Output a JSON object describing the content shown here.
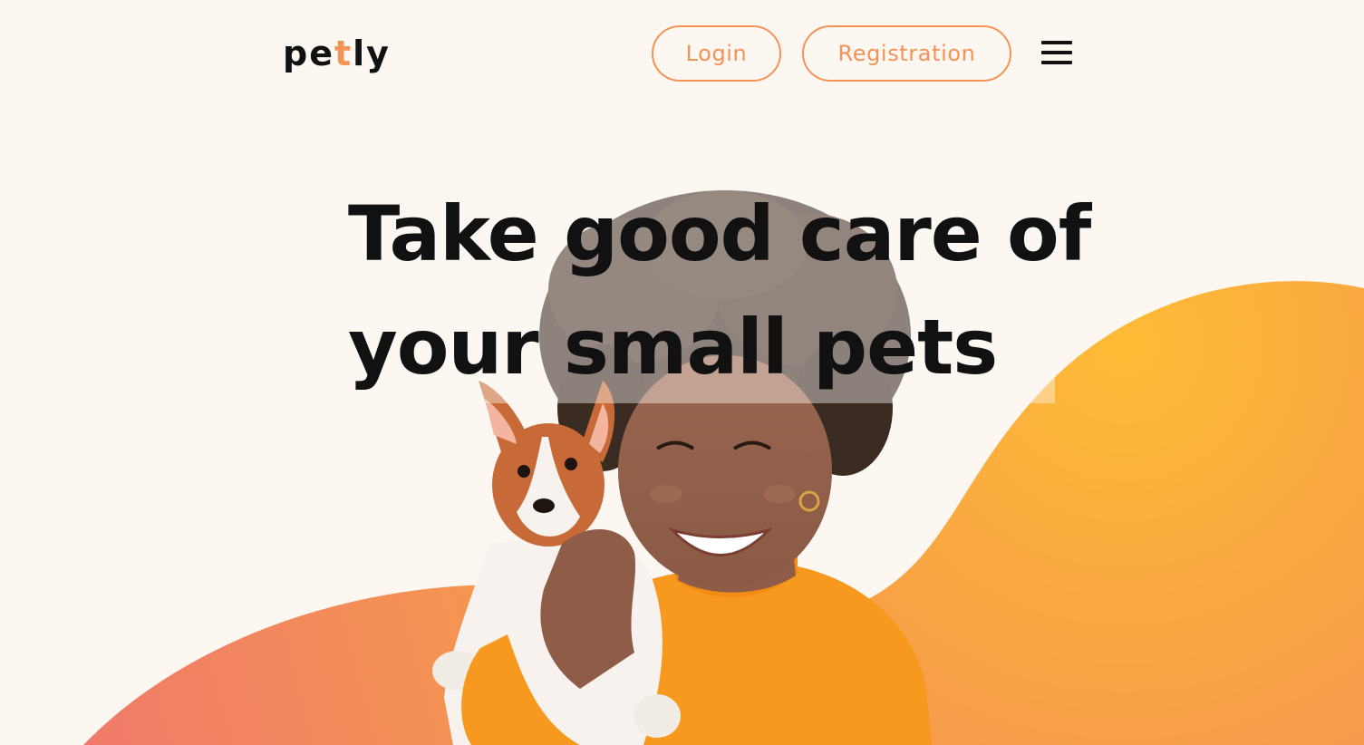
{
  "header": {
    "logo_start": "pe",
    "logo_accent": "t",
    "logo_end": "ly",
    "login_label": "Login",
    "registration_label": "Registration",
    "menu_icon": "hamburger-menu-icon"
  },
  "hero": {
    "title_line1": "Take good care of",
    "title_line2": "your small pets",
    "image_subject": "smiling woman holding a puppy"
  },
  "colors": {
    "background": "#FDF7F2",
    "accent": "#F59256",
    "text": "#111111",
    "wave_top": "#FFC135",
    "wave_bottom": "#F6A246",
    "wave_left": "#F17D67"
  }
}
